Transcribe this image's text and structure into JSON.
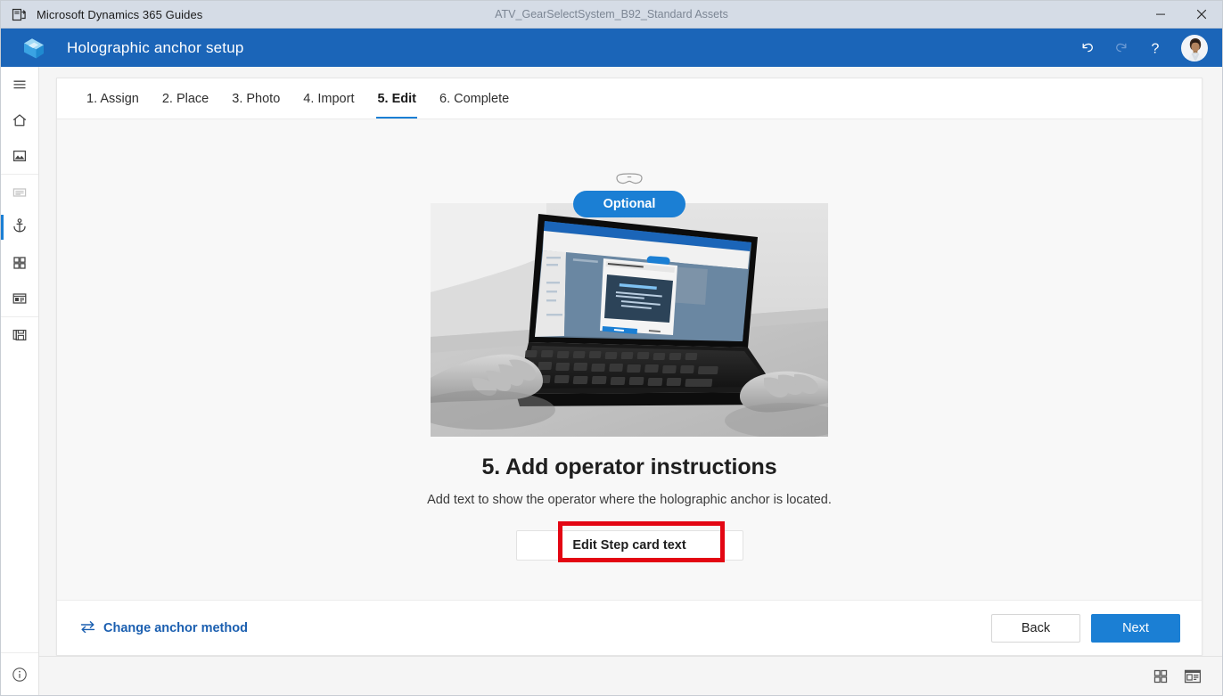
{
  "titlebar": {
    "app_icon": "dynamics-guides-app-icon",
    "app_name": "Microsoft Dynamics 365 Guides",
    "document_name": "ATV_GearSelectSystem_B92_Standard Assets",
    "minimize_label": "–",
    "close_label": "✕"
  },
  "header": {
    "logo_icon": "dynamics-365-guides-logo",
    "title": "Holographic anchor setup",
    "undo_icon": "undo-icon",
    "redo_icon": "redo-icon",
    "help_icon": "help-question-icon",
    "avatar_icon": "user-avatar",
    "accent_color": "#1b65b8"
  },
  "rail": {
    "items": [
      {
        "name": "menu-hamburger-icon",
        "label": "Menu"
      },
      {
        "name": "home-icon",
        "label": "Home"
      },
      {
        "name": "media-image-icon",
        "label": "Media"
      },
      {
        "name": "outline-text-icon",
        "label": "Outline"
      },
      {
        "name": "anchor-icon",
        "label": "Anchor"
      },
      {
        "name": "grid-apps-icon",
        "label": "Steps"
      },
      {
        "name": "step-card-icon",
        "label": "Step card"
      },
      {
        "name": "save-copy-icon",
        "label": "Save"
      }
    ],
    "bottom_icon": "info-icon",
    "active_index": 4,
    "disabled_index": 3,
    "active_indicator_color": "#1b7fd4"
  },
  "tabs": [
    {
      "label": "1. Assign",
      "active": false
    },
    {
      "label": "2. Place",
      "active": false
    },
    {
      "label": "3. Photo",
      "active": false
    },
    {
      "label": "4. Import",
      "active": false
    },
    {
      "label": "5. Edit",
      "active": true
    },
    {
      "label": "6. Complete",
      "active": false
    }
  ],
  "content": {
    "hololens_icon": "hololens-headset-icon",
    "badge_label": "Optional",
    "badge_color": "#1b7fd4",
    "photo_alt": "Hands typing on a laptop that shows the Edit anchoring instructions dialog",
    "photo_screen": {
      "dialog_title": "Edit anchoring instructions",
      "card_title": "Align Digital Anchor",
      "card_lines": [
        "1. Align \"digital anchor\" hologram to real world object.",
        "• Tap and hold the hologram to move.",
        "• Tap and hold the input."
      ],
      "primary_button": "Save",
      "secondary_button": "Cancel"
    },
    "heading": "5. Add operator instructions",
    "subheading": "Add text to show the operator where the holographic anchor is located.",
    "edit_button_label": "Edit Step card text",
    "highlight_color": "#e30613"
  },
  "footer": {
    "change_icon": "swap-arrows-icon",
    "change_label": "Change anchor method",
    "back_label": "Back",
    "next_label": "Next",
    "link_color": "#1b5fb0",
    "primary_color": "#1b7fd4"
  },
  "statusbar": {
    "grid_view_icon": "grid-view-icon",
    "detail_view_icon": "detail-view-icon"
  }
}
